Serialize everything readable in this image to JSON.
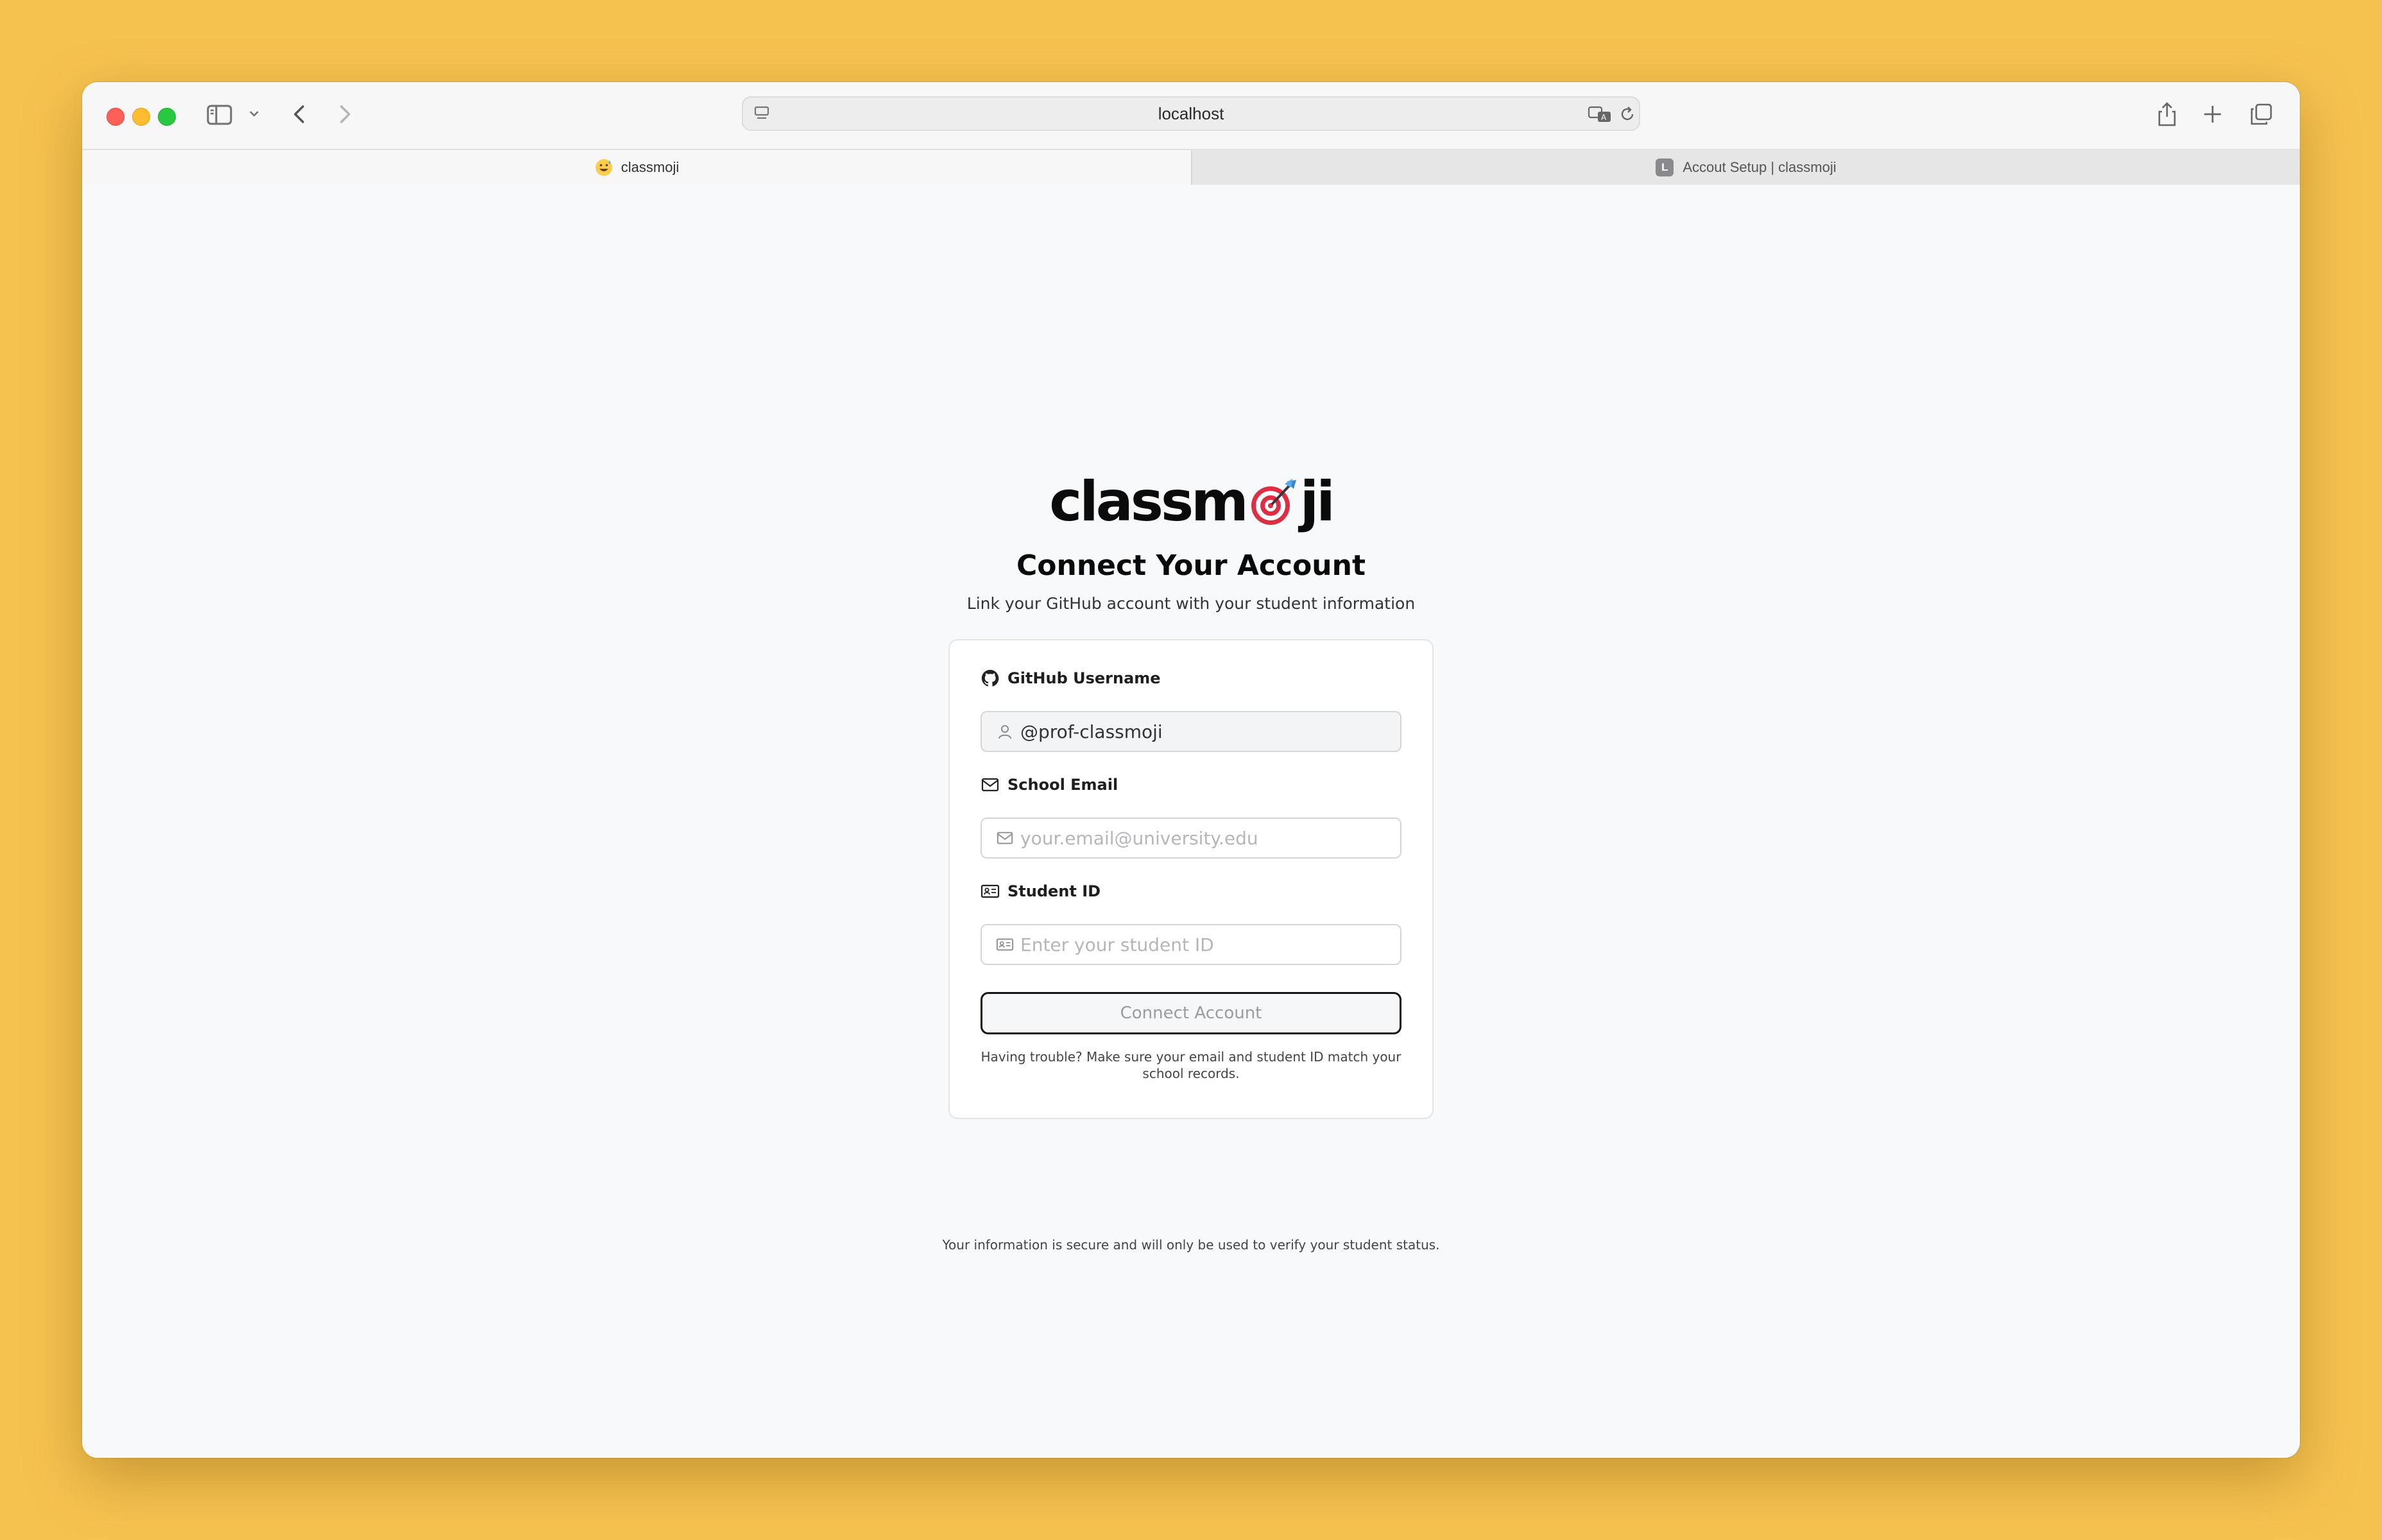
{
  "browser": {
    "url": "localhost",
    "tabs": [
      {
        "label": "classmoji",
        "favicon": "grinning-sweat-emoji",
        "active": true
      },
      {
        "label": "Accout Setup | classmoji",
        "favicon_letter": "L",
        "active": false
      }
    ]
  },
  "page": {
    "logo": {
      "text_left": "classm",
      "text_right": "ji",
      "emoji": "dart-target"
    },
    "title": "Connect Your Account",
    "subtitle": "Link your GitHub account with your student information",
    "form": {
      "github_label": "GitHub Username",
      "github_value": "@prof-classmoji",
      "email_label": "School Email",
      "email_placeholder": "your.email@university.edu",
      "student_id_label": "Student ID",
      "student_id_placeholder": "Enter your student ID",
      "submit_label": "Connect Account",
      "help_text": "Having trouble? Make sure your email and student ID match your school records."
    },
    "footer": "Your information is secure and will only be used to verify your student status."
  },
  "colors": {
    "desktop_background": "#f6c24f",
    "page_background": "#f8f9fa",
    "button_border": "#141414"
  }
}
